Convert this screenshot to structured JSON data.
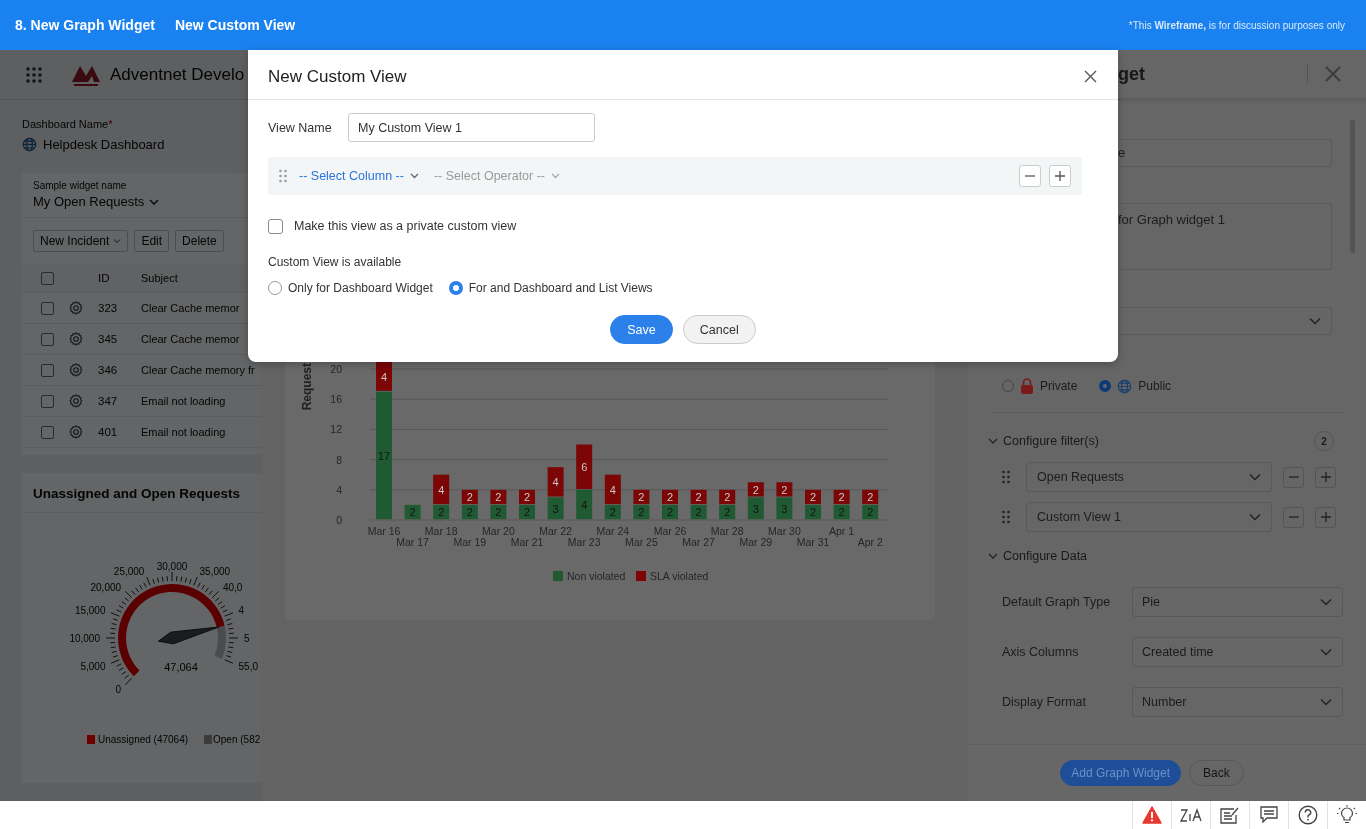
{
  "top_bar": {
    "title": "8. New Graph Widget",
    "subtitle": "New Custom View",
    "note": "*This **Wireframe,** is for discussion purposes only"
  },
  "app_header": {
    "title": "Adventnet Develo"
  },
  "dashboard": {
    "name_label": "Dashboard Name",
    "required_mark": "*",
    "name": "Helpdesk Dashboard"
  },
  "requests_widget": {
    "caption": "Sample widget name",
    "title": "My Open Requests",
    "buttons": [
      {
        "label": "New Incident",
        "kind": "dropdown"
      },
      {
        "label": "Edit",
        "kind": "plain"
      },
      {
        "label": "Delete",
        "kind": "plain"
      }
    ],
    "select_all": {
      "checked": false
    },
    "columns": [
      "ID",
      "Subject"
    ],
    "rows": [
      {
        "id": "323",
        "subject": "Clear Cache memor",
        "checked": false
      },
      {
        "id": "345",
        "subject": "Clear Cache memor",
        "checked": false
      },
      {
        "id": "346",
        "subject": "Clear Cache memory fr",
        "checked": false
      },
      {
        "id": "347",
        "subject": "Email not loading",
        "checked": false
      },
      {
        "id": "401",
        "subject": "Email not loading",
        "checked": false
      }
    ]
  },
  "gauge_widget": {
    "title": "Unassigned and Open Requests",
    "reading": "47,064",
    "scale_labels": [
      "0",
      "5,000",
      "10,000",
      "15,000",
      "20,000",
      "25,000",
      "30,000",
      "35,000",
      "40,0",
      "4",
      "5",
      "55,0"
    ],
    "legend": [
      {
        "label": "Unassigned (47064)",
        "color": "#6e0000"
      },
      {
        "label": "Open (582",
        "color": "#3c3c3c"
      }
    ]
  },
  "graph_preview": {
    "chart_data": {
      "type": "bar",
      "stacked": true,
      "ylabel": "Request",
      "data_labels": true,
      "grid": true,
      "legend": true,
      "ylim": [
        0,
        21
      ],
      "categories": [
        "Mar 16",
        "Mar 17",
        "Mar 18",
        "Mar 19",
        "Mar 20",
        "Mar 21",
        "Mar 22",
        "Mar 23",
        "Mar 24",
        "Mar 25",
        "Mar 26",
        "Mar 27",
        "Mar 28",
        "Mar 29",
        "Mar 30",
        "Mar 31",
        "Apr 1",
        "Apr 2"
      ],
      "yticks": [
        0,
        4,
        8,
        12,
        16,
        20
      ],
      "series": [
        {
          "name": "Non violated",
          "color": "#1f5a33",
          "values": [
            17,
            2,
            2,
            2,
            2,
            2,
            3,
            4,
            2,
            2,
            2,
            2,
            2,
            3,
            3,
            2,
            2,
            2
          ]
        },
        {
          "name": "SLA violated",
          "color": "#7c0606",
          "values": [
            4,
            null,
            4,
            2,
            2,
            2,
            4,
            6,
            4,
            2,
            2,
            2,
            2,
            2,
            2,
            2,
            2,
            2
          ]
        }
      ]
    }
  },
  "widget_panel": {
    "title": "get",
    "name_value": "e",
    "description_value": "for Graph widget 1",
    "visibility": [
      {
        "label": "Private",
        "kind": "private",
        "selected": false
      },
      {
        "label": "Public",
        "kind": "public",
        "selected": true
      }
    ],
    "filters": {
      "title": "Configure filter(s)",
      "expanded": true,
      "count": "2",
      "items": [
        "Open Requests",
        "Custom View 1"
      ]
    },
    "data": {
      "title": "Configure Data",
      "expanded": true,
      "fields": [
        {
          "label": "Default Graph Type",
          "value": "Pie"
        },
        {
          "label": "Axis Columns",
          "value": "Created time"
        },
        {
          "label": "Display Format",
          "value": "Number"
        }
      ]
    },
    "buttons": [
      {
        "label": "Add Graph Widget",
        "kind": "primary"
      },
      {
        "label": "Back",
        "kind": "secondary"
      }
    ]
  },
  "modal": {
    "title": "New Custom View",
    "view_name_label": "View Name",
    "view_name": "My Custom View 1",
    "criteria": {
      "column": "-- Select Column --",
      "operator": "-- Select Operator --"
    },
    "private_option": {
      "label": "Make this view as a private custom view",
      "checked": false
    },
    "availability_label": "Custom View is available",
    "availability": [
      {
        "label": "Only for Dashboard Widget",
        "selected": false
      },
      {
        "label": "For and Dashboard and List Views",
        "selected": true
      }
    ],
    "buttons": [
      {
        "label": "Save",
        "kind": "primary"
      },
      {
        "label": "Cancel",
        "kind": "secondary"
      }
    ]
  }
}
